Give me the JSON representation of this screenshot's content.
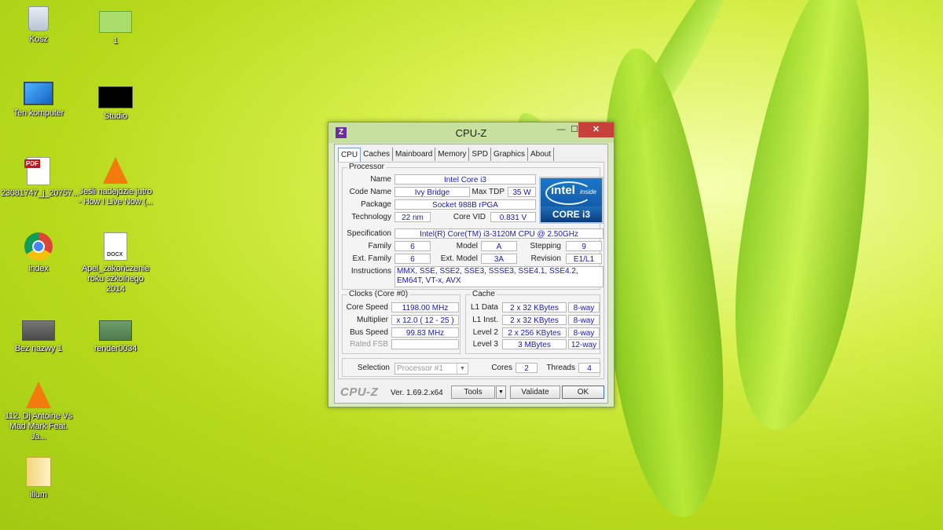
{
  "desktop": {
    "icons": [
      {
        "label": "Kosz",
        "icon": "recycle-bin-icon"
      },
      {
        "label": "1",
        "icon": "image-file-icon"
      },
      {
        "label": "Ten komputer",
        "icon": "computer-icon"
      },
      {
        "label": "Studio",
        "icon": "video-thumbnail-icon"
      },
      {
        "label": "23081747_j_20757...",
        "icon": "pdf-file-icon"
      },
      {
        "label": "Jeśli nadejdzie jutro - How I Live Now (...",
        "icon": "vlc-icon"
      },
      {
        "label": "index",
        "icon": "chrome-icon"
      },
      {
        "label": "Apel_zakończenie roku szkolnego 2014",
        "icon": "docx-file-icon"
      },
      {
        "label": "Bez nazwy 1",
        "icon": "video-thumbnail-icon"
      },
      {
        "label": "render0034",
        "icon": "image-file-icon"
      },
      {
        "label": "112. Dj Antoine Vs Mad Mark Feat. Ja...",
        "icon": "vlc-icon"
      },
      {
        "label": "illum",
        "icon": "folder-icon"
      }
    ]
  },
  "window": {
    "logo": "Z",
    "title": "CPU-Z",
    "minimize": "—",
    "maximize": "☐",
    "close": "✕"
  },
  "tabs": [
    "CPU",
    "Caches",
    "Mainboard",
    "Memory",
    "SPD",
    "Graphics",
    "About"
  ],
  "processor": {
    "group_label": "Processor",
    "name_label": "Name",
    "name": "Intel Core i3",
    "codename_label": "Code Name",
    "codename": "Ivy Bridge",
    "maxtdp_label": "Max TDP",
    "maxtdp": "35 W",
    "package_label": "Package",
    "package": "Socket 988B rPGA",
    "technology_label": "Technology",
    "technology": "22 nm",
    "corevid_label": "Core VID",
    "corevid": "0.831 V",
    "spec_label": "Specification",
    "spec": "Intel(R) Core(TM) i3-3120M CPU @ 2.50GHz",
    "family_label": "Family",
    "family": "6",
    "model_label": "Model",
    "model": "A",
    "stepping_label": "Stepping",
    "stepping": "9",
    "extfamily_label": "Ext. Family",
    "extfamily": "6",
    "extmodel_label": "Ext. Model",
    "extmodel": "3A",
    "revision_label": "Revision",
    "revision": "E1/L1",
    "instructions_label": "Instructions",
    "instructions": "MMX, SSE, SSE2, SSE3, SSSE3, SSE4.1, SSE4.2, EM64T, VT-x, AVX",
    "badge": {
      "brand": "intel",
      "inside": "inside",
      "line": "CORE i3",
      "icon": "intel-core-i3-logo"
    }
  },
  "clocks": {
    "group_label": "Clocks (Core #0)",
    "corespeed_label": "Core Speed",
    "corespeed": "1198.00 MHz",
    "multiplier_label": "Multiplier",
    "multiplier": "x 12.0 ( 12 - 25 )",
    "busspeed_label": "Bus Speed",
    "busspeed": "99.83 MHz",
    "ratedfsb_label": "Rated FSB",
    "ratedfsb": ""
  },
  "cache": {
    "group_label": "Cache",
    "l1data_label": "L1 Data",
    "l1data": "2 x 32 KBytes",
    "l1data_way": "8-way",
    "l1inst_label": "L1 Inst.",
    "l1inst": "2 x 32 KBytes",
    "l1inst_way": "8-way",
    "level2_label": "Level 2",
    "level2": "2 x 256 KBytes",
    "level2_way": "8-way",
    "level3_label": "Level 3",
    "level3": "3 MBytes",
    "level3_way": "12-way"
  },
  "selection": {
    "label": "Selection",
    "value": "Processor #1",
    "cores_label": "Cores",
    "cores": "2",
    "threads_label": "Threads",
    "threads": "4"
  },
  "footer": {
    "logo": "CPU-Z",
    "version": "Ver. 1.69.2.x64",
    "tools": "Tools",
    "validate": "Validate",
    "ok": "OK"
  }
}
